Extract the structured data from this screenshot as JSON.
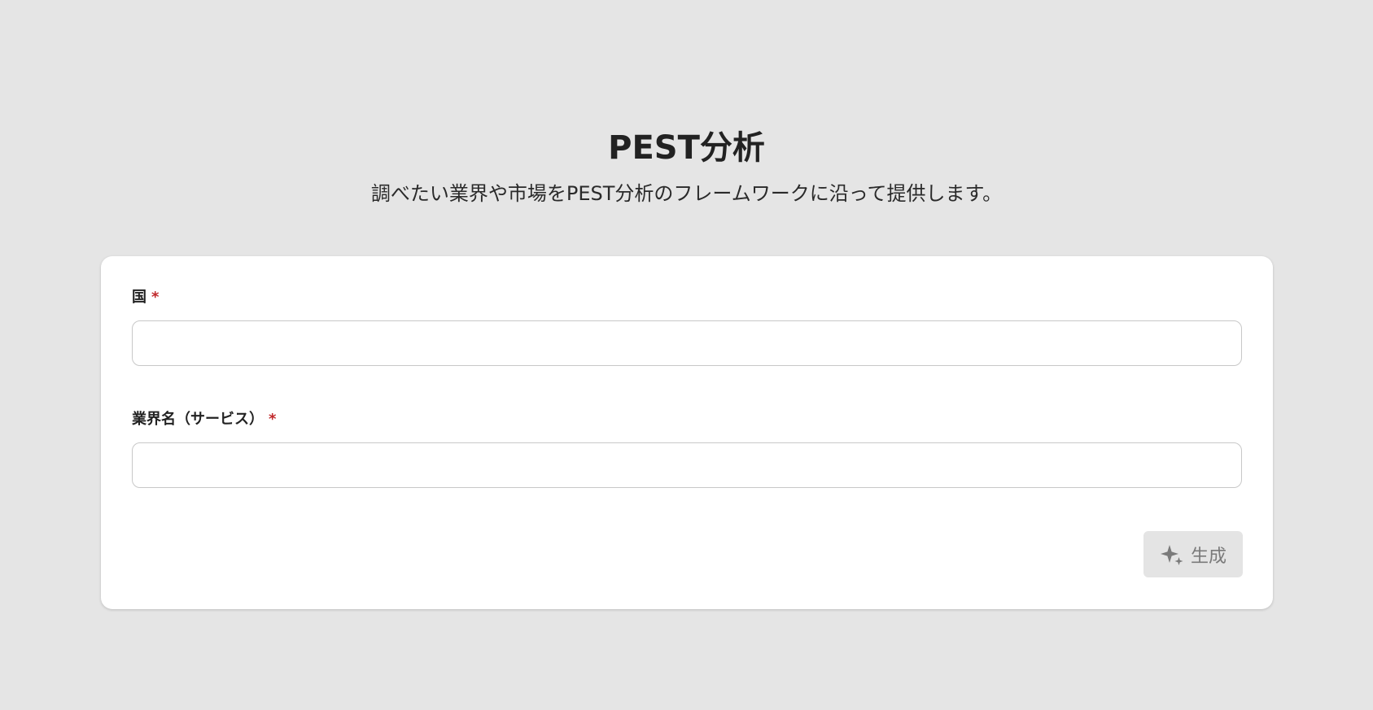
{
  "header": {
    "title": "PEST分析",
    "subtitle": "調べたい業界や市場をPEST分析のフレームワークに沿って提供します。"
  },
  "form": {
    "country": {
      "label": "国",
      "required_mark": "*",
      "value": "",
      "placeholder": ""
    },
    "industry": {
      "label": "業界名（サービス）",
      "required_mark": "*",
      "value": "",
      "placeholder": ""
    },
    "generate_button": {
      "label": "生成",
      "icon": "sparkle-icon",
      "state": "disabled"
    }
  },
  "colors": {
    "background": "#e5e5e5",
    "card": "#ffffff",
    "required": "#c0282a",
    "button_disabled_bg": "#e4e4e4",
    "button_disabled_text": "#7a7a7a"
  }
}
